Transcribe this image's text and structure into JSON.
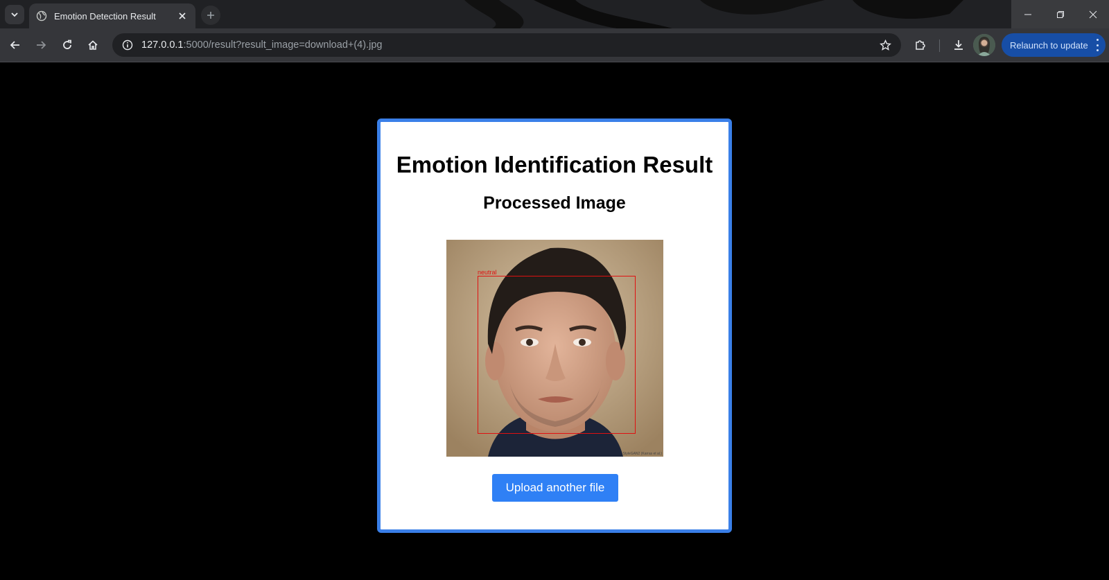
{
  "browser": {
    "tab_title": "Emotion Detection Result",
    "url_host": "127.0.0.1",
    "url_path": ":5000/result?result_image=download+(4).jpg",
    "relaunch_label": "Relaunch to update"
  },
  "page": {
    "heading": "Emotion Identification Result",
    "subheading": "Processed Image",
    "detection_label": "neutral",
    "image_watermark": "StyleGAN2 (Karras et al.)",
    "upload_button": "Upload another file"
  },
  "colors": {
    "card_border": "#3a7fe8",
    "button": "#2f80f5",
    "bbox": "#e01010",
    "relaunch_bg": "#174ea6"
  },
  "icons": [
    "tab-search-icon",
    "globe-icon",
    "close-icon",
    "plus-icon",
    "back-icon",
    "forward-icon",
    "reload-icon",
    "home-icon",
    "info-icon",
    "star-icon",
    "extensions-icon",
    "download-icon",
    "menu-icon"
  ]
}
